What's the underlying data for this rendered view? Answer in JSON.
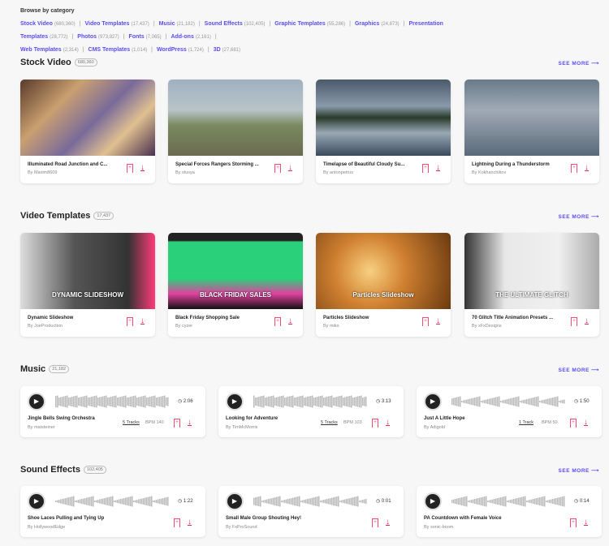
{
  "browse": {
    "label": "Browse by category",
    "categories": [
      {
        "name": "Stock Video",
        "count": "(680,360)"
      },
      {
        "name": "Video Templates",
        "count": "(17,437)"
      },
      {
        "name": "Music",
        "count": "(21,182)"
      },
      {
        "name": "Sound Effects",
        "count": "(102,405)"
      },
      {
        "name": "Graphic Templates",
        "count": "(55,286)"
      },
      {
        "name": "Graphics",
        "count": "(24,873)"
      },
      {
        "name": "Presentation Templates",
        "count": "(28,772)"
      },
      {
        "name": "Photos",
        "count": "(973,827)"
      },
      {
        "name": "Fonts",
        "count": "(7,065)"
      },
      {
        "name": "Add-ons",
        "count": "(2,161)"
      },
      {
        "name": "Web Templates",
        "count": "(2,314)"
      },
      {
        "name": "CMS Templates",
        "count": "(1,014)"
      },
      {
        "name": "WordPress",
        "count": "(1,724)"
      },
      {
        "name": "3D",
        "count": "(27,681)"
      }
    ]
  },
  "see_more": "SEE MORE",
  "stock_video": {
    "title": "Stock Video",
    "count": "680,360",
    "items": [
      {
        "title": "Illuminated Road Junction and C...",
        "author": "By Maxim8609",
        "bg": "linear-gradient(135deg,#5a3a2a,#c9a070 30%,#7a6a9a 55%,#e0c090 75%,#4a3050)"
      },
      {
        "title": "Special Forces Rangers Storming ...",
        "author": "By stusya",
        "bg": "linear-gradient(180deg,#9fb0c0,#b8c4c8 40%,#7a8a60 60%,#6a6a50)"
      },
      {
        "title": "Timelapse of Beautiful Cloudy Su...",
        "author": "By antonpetrus",
        "bg": "linear-gradient(180deg,#4a5a6a,#8a9aaa 35%,#2a3a2a 50%,#9aa8b5 70%,#3a4a5a)"
      },
      {
        "title": "Lightning During a Thunderstorm",
        "author": "By Kokhanchikov",
        "bg": "linear-gradient(180deg,#6a7a8a,#a0aab5 40%,#5a6a7a)"
      }
    ]
  },
  "video_templates": {
    "title": "Video Templates",
    "count": "17,437",
    "items": [
      {
        "title": "Dynamic Slideshow",
        "author": "By JoeProduction",
        "bg": "linear-gradient(90deg,#ddd,#555 40%,#333 80%,#ff3a7a)",
        "overlay": "DYNAMIC SLIDESHOW"
      },
      {
        "title": "Black Friday Shopping Sale",
        "author": "By cyzer",
        "bg": "linear-gradient(180deg,#222 10%,#2ad07a 12%,#2ad07a 60%,#e040a0 80%,#111)",
        "overlay": "BLACK FRIDAY SALES"
      },
      {
        "title": "Particles Slideshow",
        "author": "By  miko",
        "bg": "radial-gradient(circle at 40% 50%,#f8d080,#d08030 40%,#6a3a10)",
        "overlay": "Particles Slideshow"
      },
      {
        "title": "70 Glitch Title Animation Presets ...",
        "author": "By xFxDesigns",
        "bg": "linear-gradient(90deg,#333,#e8e8e8 30%,#f0f0f0 70%,#aaa)",
        "overlay": "THE ULTIMATE GLITCH"
      }
    ]
  },
  "music": {
    "title": "Music",
    "count": "21,182",
    "items": [
      {
        "title": "Jingle Bells Swing Orchestra",
        "author": "By matsteiner",
        "duration": "2:06",
        "tracks": "5 Tracks",
        "bpm": "BPM 140"
      },
      {
        "title": "Looking for Adventure",
        "author": "By TimMcMorris",
        "duration": "3:13",
        "tracks": "5 Tracks",
        "bpm": "BPM 103"
      },
      {
        "title": "Just A Little Hope",
        "author": "By Adigold",
        "duration": "1:50",
        "tracks": "1 Track",
        "bpm": "BPM 50"
      }
    ]
  },
  "sound_effects": {
    "title": "Sound Effects",
    "count": "102,405",
    "items": [
      {
        "title": "Shoe Laces Pulling and Tying Up",
        "author": "By HollywoodEdge",
        "duration": "1:22"
      },
      {
        "title": "Small Male Group Shouting Hey!",
        "author": "By FxProSound",
        "duration": "0:01"
      },
      {
        "title": "PA Countdown with Female Voice",
        "author": "By sonic-boom",
        "duration": "0:14"
      }
    ]
  },
  "colors": {
    "accent": "#5b4cf5",
    "action": "#e8264d"
  }
}
